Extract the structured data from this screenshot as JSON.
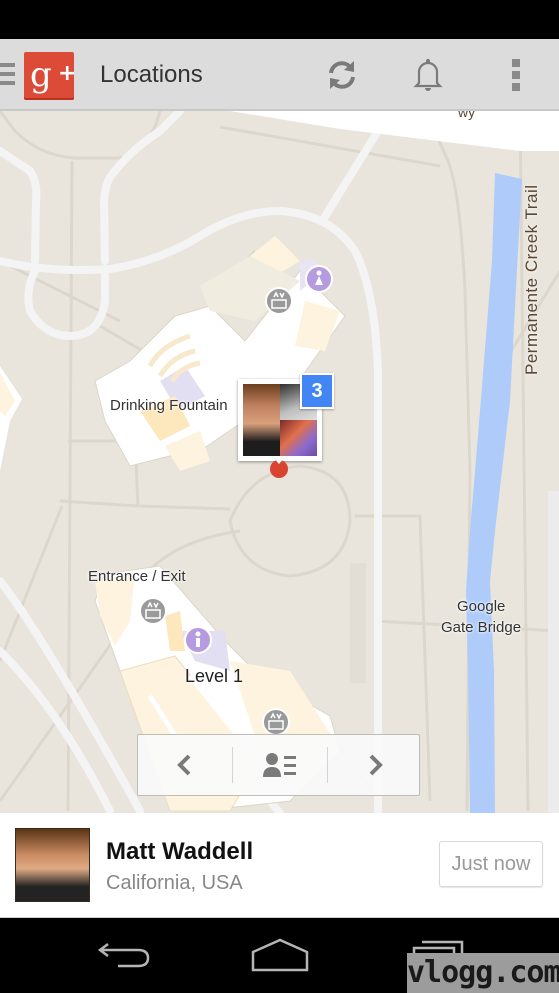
{
  "app": {
    "title": "Locations",
    "logo": "g+"
  },
  "actionbar": {
    "icons": [
      "menu-drawer-icon",
      "google-plus-logo",
      "refresh-icon",
      "notifications-bell-icon",
      "overflow-menu-icon"
    ]
  },
  "map": {
    "labels": {
      "drinking_fountain": "Drinking Fountain",
      "entrance_exit": "Entrance / Exit",
      "level": "Level 1",
      "bridge_line1": "Google",
      "bridge_line2": "Gate Bridge",
      "trail": "Permanente Creek Trail",
      "road_partial": "wy"
    },
    "cluster": {
      "count": "3"
    },
    "colors": {
      "water": "#aecbfa",
      "land": "#e9e5dc",
      "road": "#f4f4f4",
      "building": "#ffffff",
      "indoor_area": "#fdf3de",
      "badge": "#4285f4",
      "pin": "#d9432f"
    }
  },
  "navigator": {
    "prev": "previous-icon",
    "list": "people-list-icon",
    "next": "next-icon"
  },
  "person": {
    "name": "Matt Waddell",
    "location": "California, USA",
    "time": "Just now"
  },
  "system_nav": [
    "back-icon",
    "home-icon",
    "recents-icon"
  ],
  "watermark": "vlogg.com"
}
